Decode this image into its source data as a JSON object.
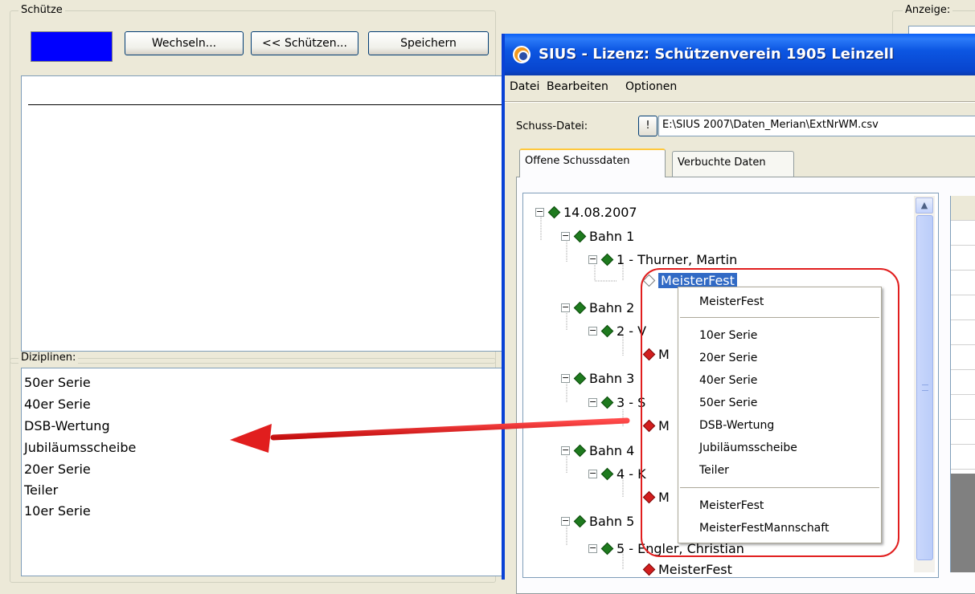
{
  "left_panel": {
    "group_schuetze": "Schütze",
    "color_swatch": "#0000FF",
    "btn_wechseln": "Wechseln...",
    "btn_schuetzen": "<< Schützen...",
    "btn_speichern": "Speichern",
    "group_diziplinen": "Diziplinen:",
    "disciplines": [
      "50er Serie",
      "40er Serie",
      "DSB-Wertung",
      "Jubiläumsscheibe",
      "20er Serie",
      "Teiler",
      "10er Serie"
    ]
  },
  "right_group": {
    "label": "Anzeige:"
  },
  "dialog": {
    "title": "SIUS - Lizenz: Schützenverein 1905 Leinzell",
    "menu": [
      "Datei",
      "Bearbeiten",
      "Optionen"
    ],
    "schuss_label": "Schuss-Datei:",
    "bang_button": "!",
    "path_value": "E:\\SIUS 2007\\Daten_Merian\\ExtNrWM.csv",
    "tabs": [
      "Offene Schussdaten",
      "Verbuchte Daten"
    ],
    "tree": {
      "date": "14.08.2007",
      "bahn1": "Bahn  1",
      "shooter1": "1 - Thurner, Martin",
      "selected": "MeisterFest",
      "bahn2": "Bahn  2",
      "shooter2": "2 - V",
      "leaf2": "M",
      "bahn3": "Bahn  3",
      "shooter3": "3 - S",
      "leaf3": "M",
      "bahn4": "Bahn  4",
      "shooter4": "4 - K",
      "leaf4": "M",
      "bahn5": "Bahn  5",
      "shooter5": "5 - Engler, Christian",
      "leaf5": "MeisterFest"
    }
  },
  "context_menu": {
    "top": "MeisterFest",
    "group1": [
      "10er Serie",
      "20er Serie",
      "40er Serie",
      "50er Serie",
      "DSB-Wertung",
      "Jubiläumsscheibe",
      "Teiler"
    ],
    "group2": [
      "MeisterFest",
      "MeisterFestMannschaft"
    ]
  },
  "colors": {
    "annotation": "#E11E1E",
    "selection": "#316AC5"
  }
}
